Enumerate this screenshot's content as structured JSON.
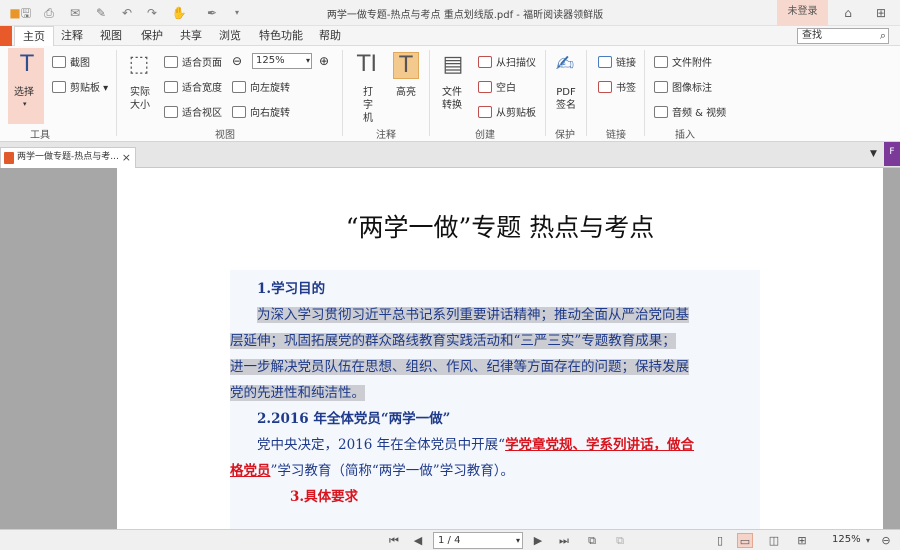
{
  "window": {
    "title": "两学一做专题-热点与考点 重点划线版.pdf - 福昕阅读器领鲜版",
    "login_label": "未登录"
  },
  "menu": {
    "tabs": [
      "主页",
      "注释",
      "视图",
      "保护",
      "共享",
      "浏览",
      "特色功能",
      "帮助"
    ],
    "search_placeholder": "查找"
  },
  "ribbon": {
    "tools": {
      "select": "选择",
      "screenshot": "截图",
      "clipboard": "剪贴板",
      "group": "工具"
    },
    "view": {
      "actual_size": "实际大小",
      "fit_page": "适合页面",
      "fit_width": "适合宽度",
      "fit_visible": "适合视区",
      "zoom": "125%",
      "rotate_left": "向左旋转",
      "rotate_right": "向右旋转",
      "group": "视图"
    },
    "comment": {
      "typewriter": "打字机",
      "highlight": "高亮",
      "group": "注释"
    },
    "create": {
      "file_convert": "文件转换",
      "from_scanner": "从扫描仪",
      "blank": "空白",
      "from_clipboard": "从剪贴板",
      "group": "创建"
    },
    "protect": {
      "pdf_sign": "PDF签名",
      "group": "保护"
    },
    "links": {
      "link": "链接",
      "bookmark": "书签",
      "group": "链接"
    },
    "insert": {
      "file_attach": "文件附件",
      "image_annot": "图像标注",
      "audio_video": "音频 & 视频",
      "group": "插入"
    }
  },
  "doc_tab": {
    "label": "两学一做专题-热点与考...",
    "side_label": "F"
  },
  "document": {
    "title": "“两学一做”专题  热点与考点",
    "h1": "1.学习目的",
    "p1_lines": [
      "为深入学习贯彻习近平总书记系列重要讲话精神；推动全面从严治党向基",
      "层延伸；巩固拓展党的群众路线教育实践活动和“三严三实”专题教育成果；",
      "进一步解决党员队伍在思想、组织、作风、纪律等方面存在的问题；保持发展",
      "党的先进性和纯洁性。"
    ],
    "h2": "2.2016 年全体党员“两学一做”",
    "p2_a": "党中央决定，2016 年在全体党员中开展“",
    "p2_red1": "学党章党规、学系列讲话，做合",
    "p2_red2": "格党员",
    "p2_b": "”学习教育（简称“两学一做”学习教育）。",
    "h3_partial": "3.具体要求"
  },
  "status": {
    "page": "1 / 4",
    "zoom": "125%"
  }
}
